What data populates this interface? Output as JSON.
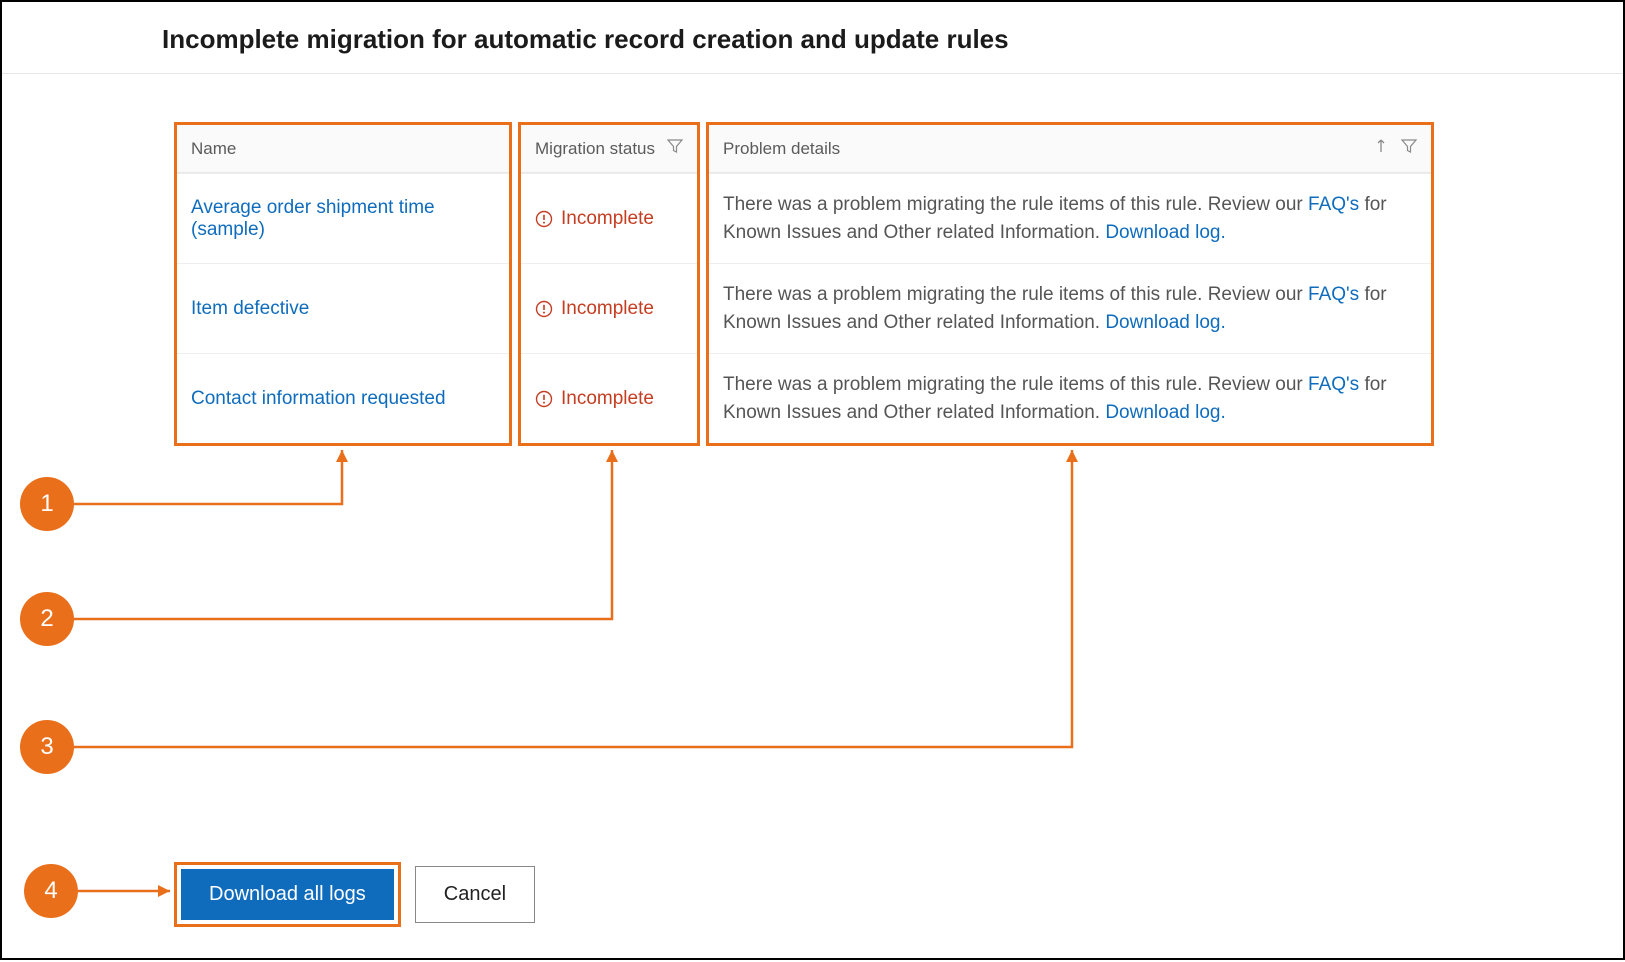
{
  "title": "Incomplete migration for automatic record creation and update rules",
  "columns": {
    "name": "Name",
    "status": "Migration status",
    "details": "Problem details"
  },
  "rows": [
    {
      "name": "Average order shipment time (sample)",
      "status": "Incomplete",
      "details_pre": "There was a problem migrating the rule items of this rule. Review our ",
      "faq_link": "FAQ's",
      "details_mid": " for Known Issues and Other related Information. ",
      "download_link": "Download log."
    },
    {
      "name": "Item defective",
      "status": "Incomplete",
      "details_pre": "There was a problem migrating the rule items of this rule. Review our ",
      "faq_link": "FAQ's",
      "details_mid": " for Known Issues and Other related Information. ",
      "download_link": "Download log."
    },
    {
      "name": "Contact information requested",
      "status": "Incomplete",
      "details_pre": "There was a problem migrating the rule items of this rule. Review our ",
      "faq_link": "FAQ's",
      "details_mid": " for Known Issues and Other related Information. ",
      "download_link": "Download log."
    }
  ],
  "callouts": {
    "c1": "1",
    "c2": "2",
    "c3": "3",
    "c4": "4"
  },
  "buttons": {
    "download_all": "Download all logs",
    "cancel": "Cancel"
  }
}
